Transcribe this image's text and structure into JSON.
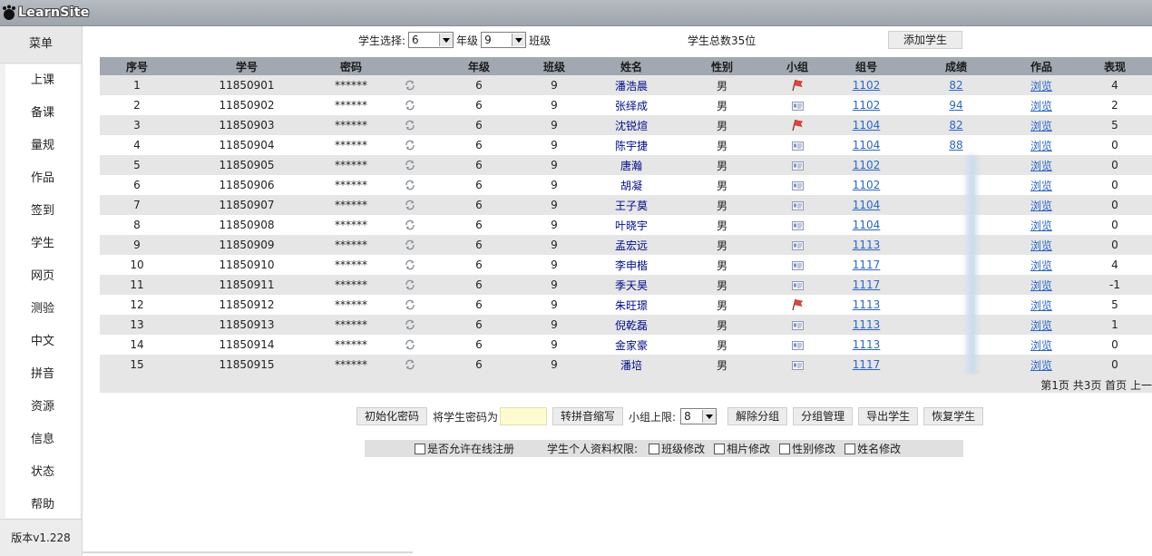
{
  "app": {
    "logo_text": "LearnSite"
  },
  "sidebar": {
    "header": "菜单",
    "items": [
      "上课",
      "备课",
      "量规",
      "作品",
      "签到",
      "学生",
      "网页",
      "测验",
      "中文",
      "拼音",
      "资源",
      "信息",
      "状态",
      "帮助"
    ],
    "version": "版本v1.228"
  },
  "filter": {
    "label": "学生选择:",
    "grade_value": "6",
    "grade_label": "年级",
    "class_value": "9",
    "class_label": "班级",
    "total": "学生总数35位",
    "add_button": "添加学生"
  },
  "table": {
    "columns": [
      "序号",
      "学号",
      "密码",
      "",
      "年级",
      "班级",
      "姓名",
      "性别",
      "小组",
      "组号",
      "成绩",
      "作品",
      "表现"
    ],
    "link_text": "浏览",
    "rows": [
      {
        "no": "1",
        "id": "11850901",
        "pw": "******",
        "grade": "6",
        "cls": "9",
        "name": "潘浩晨",
        "sex": "男",
        "leader": true,
        "group": "1102",
        "score": "82",
        "perf": "4"
      },
      {
        "no": "2",
        "id": "11850902",
        "pw": "******",
        "grade": "6",
        "cls": "9",
        "name": "张绎成",
        "sex": "男",
        "leader": false,
        "group": "1102",
        "score": "94",
        "perf": "2"
      },
      {
        "no": "3",
        "id": "11850903",
        "pw": "******",
        "grade": "6",
        "cls": "9",
        "name": "沈锐煊",
        "sex": "男",
        "leader": true,
        "group": "1104",
        "score": "82",
        "perf": "5"
      },
      {
        "no": "4",
        "id": "11850904",
        "pw": "******",
        "grade": "6",
        "cls": "9",
        "name": "陈宇捷",
        "sex": "男",
        "leader": false,
        "group": "1104",
        "score": "88",
        "perf": "0"
      },
      {
        "no": "5",
        "id": "11850905",
        "pw": "******",
        "grade": "6",
        "cls": "9",
        "name": "唐瀚",
        "sex": "男",
        "leader": false,
        "group": "1102",
        "score": "",
        "perf": "0"
      },
      {
        "no": "6",
        "id": "11850906",
        "pw": "******",
        "grade": "6",
        "cls": "9",
        "name": "胡凝",
        "sex": "男",
        "leader": false,
        "group": "1102",
        "score": "",
        "perf": "0"
      },
      {
        "no": "7",
        "id": "11850907",
        "pw": "******",
        "grade": "6",
        "cls": "9",
        "name": "王子莫",
        "sex": "男",
        "leader": false,
        "group": "1104",
        "score": "",
        "perf": "0"
      },
      {
        "no": "8",
        "id": "11850908",
        "pw": "******",
        "grade": "6",
        "cls": "9",
        "name": "叶晓宇",
        "sex": "男",
        "leader": false,
        "group": "1104",
        "score": "",
        "perf": "0"
      },
      {
        "no": "9",
        "id": "11850909",
        "pw": "******",
        "grade": "6",
        "cls": "9",
        "name": "孟宏远",
        "sex": "男",
        "leader": false,
        "group": "1113",
        "score": "",
        "perf": "0"
      },
      {
        "no": "10",
        "id": "11850910",
        "pw": "******",
        "grade": "6",
        "cls": "9",
        "name": "李申楷",
        "sex": "男",
        "leader": false,
        "group": "1117",
        "score": "",
        "perf": "4"
      },
      {
        "no": "11",
        "id": "11850911",
        "pw": "******",
        "grade": "6",
        "cls": "9",
        "name": "季天昊",
        "sex": "男",
        "leader": false,
        "group": "1117",
        "score": "",
        "perf": "-1"
      },
      {
        "no": "12",
        "id": "11850912",
        "pw": "******",
        "grade": "6",
        "cls": "9",
        "name": "朱旺璟",
        "sex": "男",
        "leader": true,
        "group": "1113",
        "score": "",
        "perf": "5"
      },
      {
        "no": "13",
        "id": "11850913",
        "pw": "******",
        "grade": "6",
        "cls": "9",
        "name": "倪乾磊",
        "sex": "男",
        "leader": false,
        "group": "1113",
        "score": "",
        "perf": "1"
      },
      {
        "no": "14",
        "id": "11850914",
        "pw": "******",
        "grade": "6",
        "cls": "9",
        "name": "金家豪",
        "sex": "男",
        "leader": false,
        "group": "1113",
        "score": "",
        "perf": "0"
      },
      {
        "no": "15",
        "id": "11850915",
        "pw": "******",
        "grade": "6",
        "cls": "9",
        "name": "潘培",
        "sex": "男",
        "leader": false,
        "group": "1117",
        "score": "",
        "perf": "0"
      }
    ]
  },
  "pager": {
    "text": "第1页 共3页 首页 上一"
  },
  "actions": {
    "init_pw": "初始化密码",
    "set_pw_label": "将学生密码为",
    "pinyin": "转拼音缩写",
    "group_limit_label": "小组上限:",
    "group_limit_value": "8",
    "ungroup": "解除分组",
    "group_manage": "分组管理",
    "export": "导出学生",
    "restore": "恢复学生"
  },
  "permissions": {
    "online_register": "是否允许在线注册",
    "profile_label": "学生个人资料权限:",
    "class_edit": "班级修改",
    "photo_edit": "相片修改",
    "sex_edit": "性别修改",
    "name_edit": "姓名修改"
  },
  "colors": {
    "topbar": "#a3a9b0",
    "header_row": "#a1a8b1",
    "odd_row": "#e6e6e6",
    "link": "#2a66c7",
    "name": "#000c8a",
    "flag": "#e0443a"
  }
}
